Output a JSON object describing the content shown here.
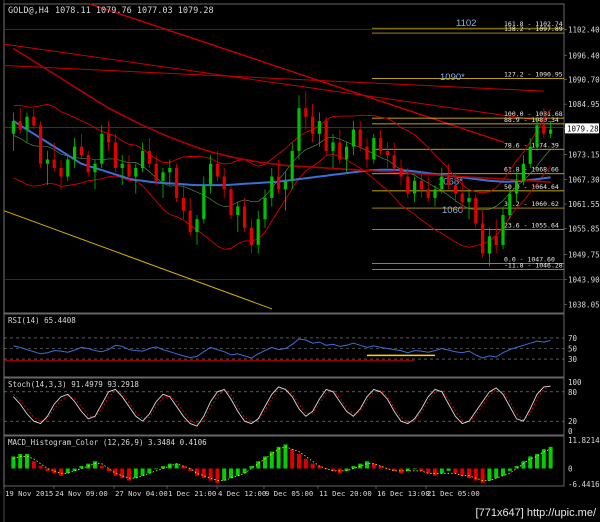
{
  "window": {
    "symbol_label": "GOLD@,H4",
    "ohlc": "1078.11 1079.76 1077.03 1079.28",
    "watermark": "[771x647] http://upic.me/"
  },
  "colors": {
    "background": "#000000",
    "grid": "#3a3a3a",
    "frame": "#808080",
    "text": "#d8d8d8",
    "bull_candle": "#00c000",
    "bear_candle": "#e00000",
    "bollinger": "#d40000",
    "ma_blue": "#3a6fd8",
    "ma_red_slow": "#b00000",
    "fib_line": "#ffd700",
    "level_line": "#c80000",
    "trendline": "#d4b000",
    "rsi_line": "#3a6fd8",
    "stoch_main": "#d8d8d8",
    "stoch_signal": "#e00000",
    "macd_up": "#00d000",
    "macd_down": "#e00000",
    "macd_signal": "#ffff00"
  },
  "chart_data": [
    {
      "type": "candlestick",
      "title": "GOLD@,H4",
      "ylim": [
        1036.05,
        1108.4
      ],
      "price_ticks": [
        1102.4,
        1096.4,
        1090.7,
        1084.95,
        1079.25,
        1073.15,
        1067.3,
        1061.55,
        1055.85,
        1049.75,
        1043.9,
        1038.05
      ],
      "current_price": "1079.28",
      "fib_levels": [
        {
          "label": "161.8 - 1102.74",
          "value": 1102.74
        },
        {
          "label": "138.2 - 1097.89",
          "value": 1101.6
        },
        {
          "label": "127.2 - 1090.95",
          "value": 1090.95
        },
        {
          "label": "100.0 - 1081.68",
          "value": 1081.68
        },
        {
          "label": "88.9 - 1080.34",
          "value": 1080.34
        },
        {
          "label": "78.6 - 1074.39",
          "value": 1074.39
        },
        {
          "label": "61.8 - 1068.66",
          "value": 1068.66
        },
        {
          "label": "50.0 - 1064.64",
          "value": 1064.64
        },
        {
          "label": "38.2 - 1060.62",
          "value": 1060.62
        },
        {
          "label": "23.6 - 1055.64",
          "value": 1055.64
        },
        {
          "label": "0.0 - 1047.60",
          "value": 1047.6
        },
        {
          "label": "-11.8 - 1046.28",
          "value": 1046.28
        }
      ],
      "annotations": [
        {
          "text": "1102",
          "price": 1104.0
        },
        {
          "text": "1090*",
          "price": 1091.3
        },
        {
          "text": "1068*",
          "price": 1066.8
        },
        {
          "text": "1060",
          "price": 1060.2
        }
      ],
      "horizontal_levels": [
        1102.4,
        1079.5,
        1043.9
      ],
      "candles": [
        [
          1078,
          1083,
          1074,
          1081
        ],
        [
          1081,
          1084,
          1078,
          1079
        ],
        [
          1079,
          1083,
          1076,
          1082
        ],
        [
          1082,
          1084,
          1079,
          1080
        ],
        [
          1080,
          1081,
          1070,
          1071
        ],
        [
          1071,
          1074,
          1066,
          1072
        ],
        [
          1072,
          1076,
          1069,
          1070
        ],
        [
          1070,
          1072,
          1065,
          1068
        ],
        [
          1068,
          1073,
          1067,
          1072
        ],
        [
          1072,
          1077,
          1070,
          1075
        ],
        [
          1075,
          1078,
          1072,
          1073
        ],
        [
          1073,
          1074,
          1068,
          1069
        ],
        [
          1069,
          1072,
          1065,
          1071
        ],
        [
          1071,
          1080,
          1070,
          1078
        ],
        [
          1078,
          1081,
          1074,
          1076
        ],
        [
          1076,
          1078,
          1069,
          1070
        ],
        [
          1070,
          1073,
          1066,
          1071
        ],
        [
          1071,
          1073,
          1067,
          1068
        ],
        [
          1068,
          1071,
          1064,
          1070
        ],
        [
          1070,
          1076,
          1069,
          1074
        ],
        [
          1074,
          1077,
          1070,
          1071
        ],
        [
          1071,
          1073,
          1066,
          1067
        ],
        [
          1067,
          1070,
          1063,
          1069
        ],
        [
          1069,
          1072,
          1066,
          1070
        ],
        [
          1070,
          1071,
          1062,
          1063
        ],
        [
          1063,
          1066,
          1058,
          1060
        ],
        [
          1060,
          1063,
          1054,
          1055
        ],
        [
          1055,
          1059,
          1052,
          1058
        ],
        [
          1058,
          1068,
          1057,
          1066
        ],
        [
          1066,
          1073,
          1064,
          1071
        ],
        [
          1071,
          1074,
          1067,
          1068
        ],
        [
          1068,
          1070,
          1063,
          1065
        ],
        [
          1065,
          1066,
          1058,
          1059
        ],
        [
          1059,
          1062,
          1055,
          1061
        ],
        [
          1061,
          1063,
          1055,
          1056
        ],
        [
          1056,
          1058,
          1050,
          1052
        ],
        [
          1052,
          1060,
          1050,
          1058
        ],
        [
          1058,
          1065,
          1056,
          1063
        ],
        [
          1063,
          1070,
          1061,
          1068
        ],
        [
          1068,
          1072,
          1064,
          1065
        ],
        [
          1065,
          1069,
          1060,
          1067
        ],
        [
          1067,
          1076,
          1065,
          1074
        ],
        [
          1074,
          1087,
          1072,
          1084
        ],
        [
          1084,
          1088,
          1079,
          1082
        ],
        [
          1082,
          1085,
          1076,
          1078
        ],
        [
          1078,
          1083,
          1075,
          1081
        ],
        [
          1081,
          1082,
          1073,
          1074
        ],
        [
          1074,
          1078,
          1070,
          1076
        ],
        [
          1076,
          1079,
          1071,
          1072
        ],
        [
          1072,
          1076,
          1069,
          1075
        ],
        [
          1075,
          1081,
          1073,
          1079
        ],
        [
          1079,
          1081,
          1074,
          1075
        ],
        [
          1075,
          1077,
          1070,
          1072
        ],
        [
          1072,
          1078,
          1071,
          1077
        ],
        [
          1077,
          1079,
          1073,
          1074
        ],
        [
          1074,
          1076,
          1070,
          1073
        ],
        [
          1073,
          1076,
          1069,
          1070
        ],
        [
          1070,
          1072,
          1066,
          1068
        ],
        [
          1068,
          1070,
          1063,
          1064
        ],
        [
          1064,
          1068,
          1062,
          1067
        ],
        [
          1067,
          1069,
          1063,
          1065
        ],
        [
          1065,
          1068,
          1062,
          1063
        ],
        [
          1063,
          1066,
          1061,
          1065
        ],
        [
          1065,
          1070,
          1064,
          1068
        ],
        [
          1068,
          1071,
          1065,
          1066
        ],
        [
          1066,
          1069,
          1062,
          1064
        ],
        [
          1064,
          1067,
          1060,
          1062
        ],
        [
          1062,
          1065,
          1058,
          1063
        ],
        [
          1063,
          1064,
          1056,
          1057
        ],
        [
          1057,
          1060,
          1049,
          1050
        ],
        [
          1050,
          1056,
          1047,
          1054
        ],
        [
          1054,
          1058,
          1050,
          1052
        ],
        [
          1052,
          1061,
          1051,
          1059
        ],
        [
          1059,
          1066,
          1058,
          1064
        ],
        [
          1064,
          1069,
          1062,
          1067
        ],
        [
          1067,
          1073,
          1066,
          1071
        ],
        [
          1071,
          1077,
          1070,
          1075
        ],
        [
          1075,
          1082,
          1074,
          1080
        ],
        [
          1080,
          1084,
          1077,
          1078
        ],
        [
          1078,
          1081,
          1077,
          1079
        ]
      ],
      "series": [
        {
          "name": "SMA",
          "color": "ma_blue",
          "values": [
            1081,
            1080,
            1079,
            1078,
            1077,
            1076,
            1075,
            1074,
            1073,
            1072,
            1071,
            1070.5,
            1070,
            1069.5,
            1069,
            1068.5,
            1068,
            1067.5,
            1067.2,
            1067,
            1066.8,
            1066.6,
            1066.5,
            1066.4,
            1066.3,
            1066.2,
            1066.1,
            1066,
            1066,
            1066,
            1066,
            1066,
            1066.1,
            1066.2,
            1066.3,
            1066.4,
            1066.5,
            1066.6,
            1066.7,
            1066.8,
            1067,
            1067.2,
            1067.4,
            1067.6,
            1067.8,
            1068,
            1068.2,
            1068.4,
            1068.6,
            1068.8,
            1069,
            1069.2,
            1069.4,
            1069.5,
            1069.6,
            1069.6,
            1069.6,
            1069.5,
            1069.4,
            1069.2,
            1069,
            1068.8,
            1068.6,
            1068.4,
            1068.2,
            1068,
            1067.8,
            1067.6,
            1067.4,
            1067.2,
            1067,
            1066.9,
            1066.8,
            1066.8,
            1066.9,
            1067,
            1067.2,
            1067.4,
            1067.6,
            1067.8
          ]
        },
        {
          "name": "SMA slow",
          "color": "ma_red_slow",
          "values": [
            1098,
            1097,
            1096,
            1095,
            1094,
            1093,
            1092,
            1091,
            1090,
            1089,
            1088,
            1087,
            1086,
            1085,
            1084,
            1083.2,
            1082.4,
            1081.6,
            1080.8,
            1080,
            1079.3,
            1078.6,
            1077.9,
            1077.2,
            1076.6,
            1076,
            1075.4,
            1074.8,
            1074.3,
            1073.8,
            1073.4,
            1073,
            1072.6,
            1072.3,
            1072,
            1071.7,
            1071.4,
            1071.2,
            1071,
            1070.8,
            1070.6,
            1070.5,
            1070.4,
            1070.3,
            1070.2,
            1070.1,
            1070,
            1069.9,
            1069.8,
            1069.7,
            1069.6,
            1069.5,
            1069.4,
            1069.3,
            1069.2,
            1069.1,
            1069,
            1068.9,
            1068.8,
            1068.7,
            1068.6,
            1068.5,
            1068.4,
            1068.3,
            1068.2,
            1068.1,
            1068,
            1067.9,
            1067.8,
            1067.7,
            1067.6,
            1067.5,
            1067.4,
            1067.3,
            1067.2,
            1067.1,
            1067,
            1066.9,
            1066.8,
            1066.7
          ]
        }
      ],
      "x_tick_labels": [
        "19 Nov 2015",
        "24 Nov 09:00",
        "27 Nov 04:00",
        "1 Dec 21:00",
        "4 Dec 12:00",
        "9 Dec 05:00",
        "11 Dec 20:00",
        "16 Dec 13:00",
        "21 Dec 05:00"
      ]
    },
    {
      "type": "line",
      "title": "RSI(14) 65.4408",
      "ylim": [
        0,
        100
      ],
      "ticks": [
        "70",
        "50",
        "30"
      ],
      "levels": [
        70,
        50,
        30
      ],
      "series": [
        {
          "name": "RSI(14)",
          "values": [
            55,
            52,
            48,
            44,
            40,
            42,
            46,
            45,
            43,
            47,
            52,
            50,
            46,
            44,
            48,
            56,
            54,
            48,
            46,
            45,
            50,
            53,
            48,
            44,
            40,
            36,
            33,
            35,
            44,
            52,
            48,
            44,
            38,
            40,
            36,
            32,
            40,
            46,
            52,
            48,
            50,
            58,
            68,
            66,
            60,
            62,
            56,
            58,
            54,
            56,
            60,
            56,
            52,
            55,
            52,
            50,
            48,
            46,
            42,
            46,
            45,
            43,
            46,
            50,
            47,
            44,
            42,
            45,
            38,
            32,
            36,
            34,
            42,
            48,
            52,
            56,
            60,
            64,
            62,
            65.44
          ]
        }
      ],
      "overbought_marker": [
        52,
        54,
        56,
        58,
        60,
        62
      ]
    },
    {
      "type": "line",
      "title": "Stoch(14,3,3) 91.4979 93.2918",
      "ylim": [
        0,
        100
      ],
      "ticks": [
        "100",
        "80",
        "20",
        "0"
      ],
      "levels": [
        80,
        20
      ],
      "series": [
        {
          "name": "Main",
          "values": [
            70,
            55,
            35,
            20,
            15,
            30,
            55,
            70,
            75,
            60,
            40,
            25,
            30,
            55,
            80,
            85,
            70,
            50,
            30,
            20,
            35,
            60,
            75,
            70,
            50,
            30,
            15,
            10,
            30,
            60,
            80,
            85,
            65,
            40,
            20,
            15,
            25,
            50,
            75,
            90,
            85,
            70,
            45,
            30,
            40,
            65,
            85,
            80,
            60,
            40,
            30,
            45,
            70,
            85,
            80,
            65,
            40,
            20,
            15,
            25,
            45,
            70,
            85,
            80,
            55,
            30,
            15,
            20,
            40,
            60,
            80,
            88,
            75,
            50,
            25,
            20,
            45,
            75,
            90,
            91.5
          ]
        },
        {
          "name": "Signal",
          "values": [
            75,
            62,
            45,
            28,
            20,
            25,
            45,
            62,
            72,
            66,
            50,
            32,
            28,
            45,
            70,
            82,
            76,
            58,
            38,
            25,
            28,
            50,
            68,
            72,
            60,
            40,
            22,
            14,
            22,
            48,
            72,
            82,
            74,
            50,
            28,
            18,
            22,
            42,
            66,
            84,
            86,
            76,
            55,
            36,
            36,
            56,
            78,
            82,
            68,
            48,
            34,
            40,
            62,
            80,
            82,
            70,
            48,
            28,
            18,
            22,
            38,
            60,
            80,
            82,
            64,
            40,
            22,
            18,
            32,
            52,
            72,
            85,
            80,
            60,
            35,
            22,
            36,
            66,
            85,
            93.3
          ]
        }
      ]
    },
    {
      "type": "bar",
      "title": "MACD_Histogram_Color (12,26,9) 3.3484 0.4106",
      "ylim": [
        -6.4416,
        11.8214
      ],
      "ticks": [
        "11.8214",
        "0",
        "-6.4416"
      ],
      "values": [
        5,
        6,
        6,
        3,
        1,
        -1,
        -2,
        -3,
        -2,
        -1,
        1,
        2,
        3,
        1,
        -1,
        -3,
        -4,
        -5,
        -4,
        -3,
        -2,
        0,
        1,
        2,
        2,
        1,
        -1,
        -3,
        -4,
        -5,
        -6,
        -5,
        -4,
        -3,
        -2,
        1,
        3,
        5,
        7,
        9,
        10,
        8,
        6,
        4,
        2,
        1,
        0,
        -1,
        -2,
        -1,
        1,
        2,
        3,
        2,
        1,
        0,
        -1,
        -2,
        -1,
        0,
        -1,
        -2,
        -3,
        -2,
        -1,
        -2,
        -3,
        -4,
        -5,
        -6,
        -5,
        -4,
        -3,
        -1,
        1,
        3,
        5,
        6,
        8,
        9
      ],
      "signal": [
        4,
        5,
        5,
        4,
        2,
        0,
        -1,
        -2,
        -2,
        -1,
        0,
        1,
        2,
        2,
        0,
        -2,
        -3,
        -4,
        -4,
        -3,
        -2,
        -1,
        0,
        1,
        2,
        1,
        0,
        -2,
        -3,
        -4,
        -5,
        -5,
        -4,
        -3,
        -2,
        0,
        2,
        4,
        6,
        8,
        9,
        8,
        7,
        5,
        3,
        1,
        0,
        -1,
        -1,
        -1,
        0,
        1,
        2,
        2,
        1,
        0,
        -1,
        -1,
        -1,
        -1,
        -1,
        -2,
        -2,
        -2,
        -2,
        -2,
        -3,
        -3,
        -4,
        -5,
        -5,
        -4,
        -3,
        -2,
        0,
        2,
        4,
        5,
        7,
        8
      ]
    }
  ]
}
